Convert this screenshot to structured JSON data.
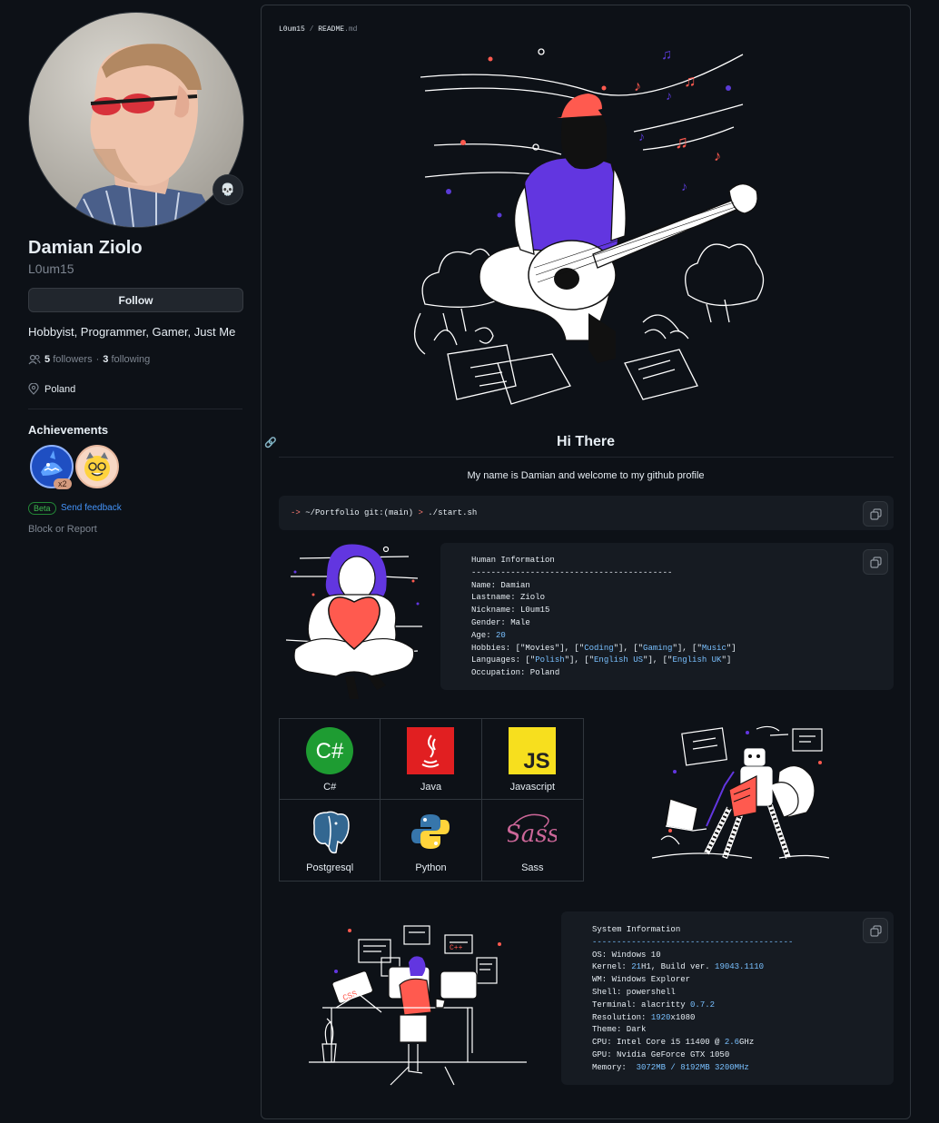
{
  "profile": {
    "fullname": "Damian Ziolo",
    "login": "L0um15",
    "follow_label": "Follow",
    "bio": "Hobbyist, Programmer, Gamer, Just Me",
    "followers_count": "5",
    "followers_label": "followers",
    "separator": "·",
    "following_count": "3",
    "following_label": "following",
    "location": "Poland",
    "status_emoji": "💀"
  },
  "achievements": {
    "title": "Achievements",
    "badge_multiplier": "x2",
    "beta_label": "Beta",
    "feedback_label": "Send feedback",
    "block_label": "Block or Report"
  },
  "readme": {
    "breadcrumb_user": "L0um15",
    "breadcrumb_sep": "/",
    "breadcrumb_file": "README",
    "breadcrumb_ext": ".md",
    "heading": "Hi There",
    "welcome": "My name is Damian and welcome to my github profile",
    "command": {
      "arrow": "->",
      "path": "~/Portfolio git:(main)",
      "prompt": ">",
      "script": "./start.sh"
    },
    "human_info": {
      "title": "Human Information",
      "rule": "-----------------------------------------",
      "name": "Name: Damian",
      "lastname": "Lastname: Ziolo",
      "nickname": "Nickname: L0um15",
      "gender": "Gender: Male",
      "age_key": "Age: ",
      "age_val": "20",
      "hobbies_pre": "Hobbies: [\"Movies\"], [\"",
      "hobbies_1": "Coding",
      "hobbies_mid1": "\"], [\"",
      "hobbies_2": "Gaming",
      "hobbies_mid2": "\"], [\"",
      "hobbies_3": "Music",
      "hobbies_post": "\"]",
      "languages_pre": "Languages: [\"",
      "languages_1": "Polish",
      "languages_mid1": "\"], [\"",
      "languages_2": "English US",
      "languages_mid2": "\"], [\"",
      "languages_3": "English UK",
      "languages_post": "\"]",
      "occupation": "Occupation: Poland"
    },
    "skills": [
      {
        "label": "C#",
        "icon": "csharp-icon"
      },
      {
        "label": "Java",
        "icon": "java-icon"
      },
      {
        "label": "Javascript",
        "icon": "javascript-icon"
      },
      {
        "label": "Postgresql",
        "icon": "postgresql-icon"
      },
      {
        "label": "Python",
        "icon": "python-icon"
      },
      {
        "label": "Sass",
        "icon": "sass-icon"
      }
    ],
    "system_info": {
      "title": "System Information",
      "rule": "-----------------------------------------",
      "os": "OS: Windows 10",
      "kernel_pre": "Kernel: ",
      "kernel_a": "21",
      "kernel_b": "H1, Build ver. ",
      "kernel_c": "19043.1110",
      "wm": "WM: Windows Explorer",
      "shell": "Shell: powershell",
      "terminal_pre": "Terminal: alacritty ",
      "terminal_ver": "0.7.2",
      "resolution_pre": "Resolution: ",
      "resolution_w": "1920",
      "resolution_x": "x1080",
      "theme": "Theme: Dark",
      "cpu_pre": "CPU: Intel Core i5 11400 @ ",
      "cpu_ghz": "2.6",
      "cpu_post": "GHz",
      "gpu": "GPU: Nvidia GeForce GTX 1050",
      "memory_pre": "Memory:  ",
      "memory_val": "3072MB / 8192MB 3200MHz"
    }
  },
  "colors": {
    "background": "#0d1117",
    "link": "#4493f8",
    "accent_red": "#ff7b72",
    "accent_blue": "#79c0ff"
  }
}
